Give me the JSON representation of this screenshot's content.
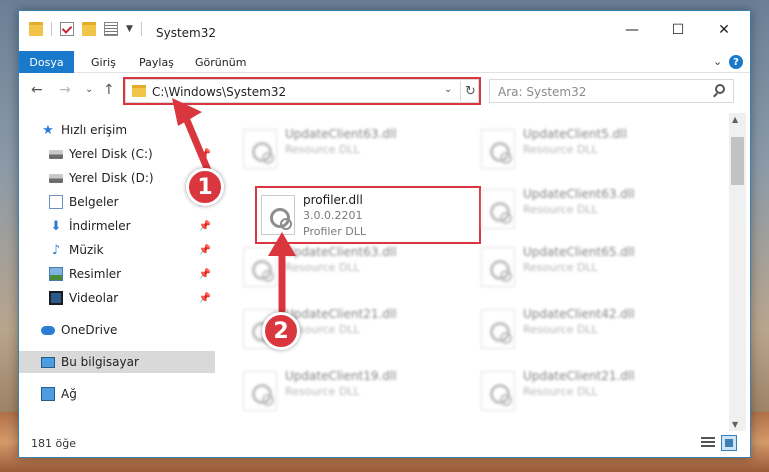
{
  "window": {
    "title": "System32",
    "controls": {
      "minimize": "—",
      "maximize": "☐",
      "close": "✕"
    }
  },
  "ribbon": {
    "tabs": [
      "Dosya",
      "Giriş",
      "Paylaş",
      "Görünüm"
    ],
    "expand_icon": "⌄",
    "help_icon": "?"
  },
  "navigation": {
    "back": "←",
    "forward": "→",
    "recent": "⌄",
    "up": "↑",
    "address": "C:\\Windows\\System32",
    "address_chevron": "⌄",
    "refresh": "↻",
    "search_placeholder": "Ara: System32"
  },
  "sidebar": {
    "items": [
      {
        "label": "Hızlı erişim",
        "icon": "star-icon"
      },
      {
        "label": "Yerel Disk (C:)",
        "icon": "disk-icon",
        "pinned": true
      },
      {
        "label": "Yerel Disk (D:)",
        "icon": "disk-icon"
      },
      {
        "label": "Belgeler",
        "icon": "document-icon",
        "pinned": true
      },
      {
        "label": "İndirmeler",
        "icon": "download-icon",
        "pinned": true
      },
      {
        "label": "Müzik",
        "icon": "music-icon",
        "pinned": true
      },
      {
        "label": "Resimler",
        "icon": "picture-icon",
        "pinned": true
      },
      {
        "label": "Videolar",
        "icon": "video-icon",
        "pinned": true
      },
      {
        "label": "OneDrive",
        "icon": "cloud-icon"
      },
      {
        "label": "Bu bilgisayar",
        "icon": "computer-icon",
        "selected": true
      },
      {
        "label": "Ağ",
        "icon": "network-icon"
      }
    ],
    "pin_glyph": "📌"
  },
  "files": {
    "left": [
      {
        "name": "UpdateClient63.dll",
        "type": "Resource DLL"
      },
      {
        "name": "profiler.dll",
        "version": "3.0.0.2201",
        "type": "Profiler DLL"
      },
      {
        "name": "UpdateClient63.dll",
        "type": "Resource DLL"
      },
      {
        "name": "UpdateClient21.dll",
        "type": "Resource DLL"
      },
      {
        "name": "UpdateClient19.dll",
        "type": "Resource DLL"
      }
    ],
    "right": [
      {
        "name": "UpdateClient5.dll",
        "type": "Resource DLL"
      },
      {
        "name": "UpdateClient63.dll",
        "type": "Resource DLL"
      },
      {
        "name": "UpdateClient65.dll",
        "type": "Resource DLL"
      },
      {
        "name": "UpdateClient42.dll",
        "type": "Resource DLL"
      },
      {
        "name": "UpdateClient21.dll",
        "type": "Resource DLL"
      }
    ]
  },
  "status": {
    "count": "181 öğe"
  },
  "annotations": {
    "step1": "1",
    "step2": "2",
    "color": "#d9363e"
  }
}
